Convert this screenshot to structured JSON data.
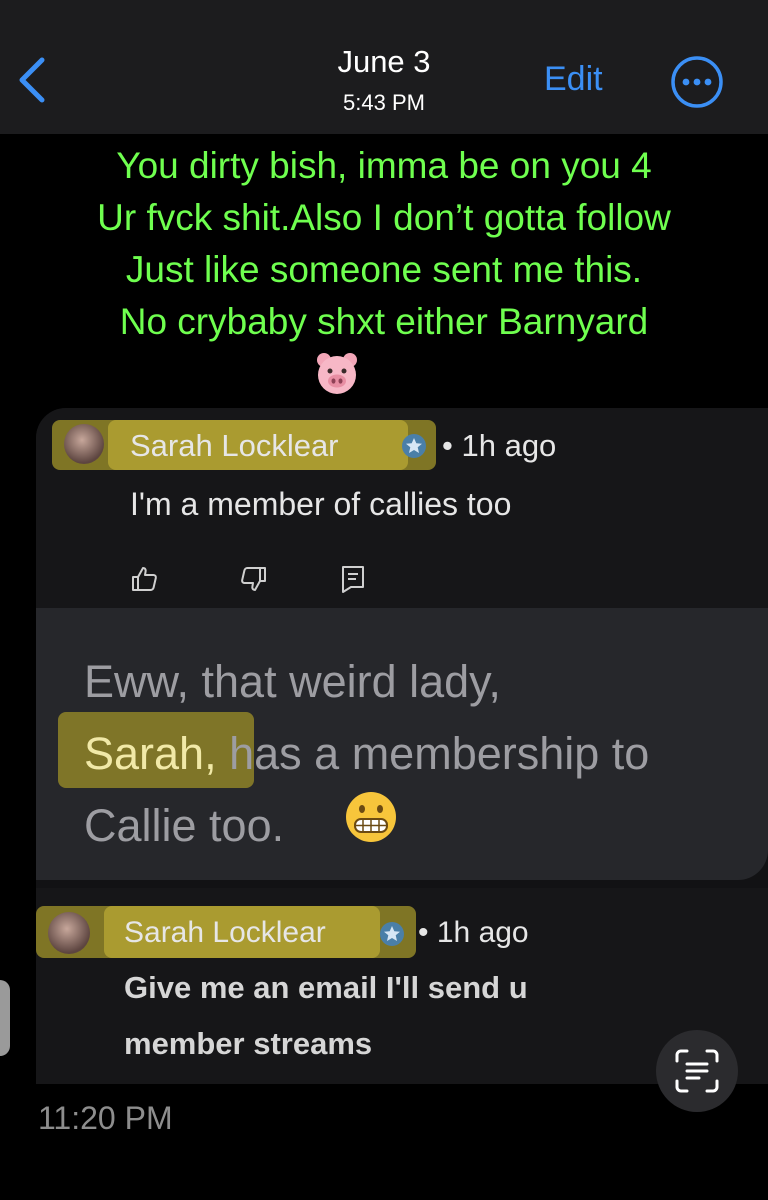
{
  "header": {
    "date": "June 3",
    "time": "5:43 PM",
    "edit_label": "Edit",
    "back_icon": "chevron-left-icon",
    "more_icon": "ellipsis-circle-icon",
    "accent_color": "#3b8ff5"
  },
  "message": {
    "lines": [
      "You dirty bish, imma be on you 4",
      "Ur fvck shit.Also I don’t gotta follow",
      "Just like someone sent me this.",
      "No crybaby shxt either Barnyard"
    ],
    "emoji": "pig-face-icon",
    "text_color": "#6fff4f"
  },
  "screenshot": {
    "comment1": {
      "author": "Sarah Locklear",
      "separator": "•",
      "time": "1h ago",
      "text": "I'm a member of callies too",
      "actions": [
        "thumbs-up-icon",
        "thumbs-down-icon",
        "reply-icon"
      ]
    },
    "quote": {
      "part1": "Eww, that weird lady,",
      "highlight": "Sarah,",
      "part2": "has a membership to",
      "part3": "Callie too.",
      "emoji": "grimacing-face-icon"
    },
    "comment2": {
      "author": "Sarah Locklear",
      "separator": "•",
      "time": "1h ago",
      "line1": "Give me an email I'll send u",
      "line2": "member streams"
    }
  },
  "footer": {
    "timestamp": "11:20 PM",
    "live_text_icon": "live-text-scan-icon"
  }
}
